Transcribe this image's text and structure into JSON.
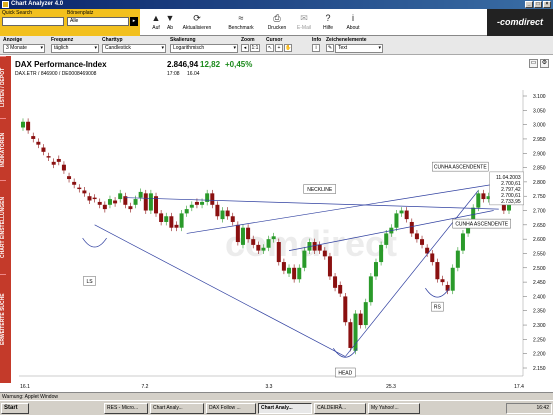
{
  "window": {
    "title": "Chart Analyzer 4.0"
  },
  "toolbar": {
    "quick_search_label": "Quick Search",
    "quick_search_value": "",
    "boersenplatz_label": "Börsenplatz",
    "boersenplatz_value": "Alle",
    "buttons": [
      "Auf",
      "Ab",
      "Aktualisieren",
      "Benchmark",
      "Drucken",
      "E-Mail",
      "Hilfe",
      "About"
    ],
    "logo": "-comdirect"
  },
  "controls": {
    "anzeige_label": "Anzeige",
    "anzeige_value": "3 Monate",
    "frequenz_label": "Frequenz",
    "frequenz_value": "täglich",
    "charttyp_label": "Charttyp",
    "charttyp_value": "Candlestick",
    "skalierung_label": "Skalierung",
    "skalierung_value": "Logarithmisch",
    "zoom_label": "Zoom",
    "zoom_value": "1:1",
    "cursor_label": "Cursor",
    "info_label": "Info",
    "zeichen_label": "Zeichenelemente",
    "zeichen_value": "Text"
  },
  "sidebar": {
    "tabs": [
      "LISTEN / DEPOT",
      "INDIKATOREN",
      "CHART EINSTELLUNGEN",
      "ERWEITERTE SUCHE"
    ]
  },
  "chart_header": {
    "title": "DAX Performance-Index",
    "subtitle": "DAX.ETR / 846900 / DE0008469008",
    "price": "2.846,94",
    "change": "12,82",
    "change_pct": "+0,45%",
    "time1": "17:08",
    "time2": "16.04"
  },
  "chart_data": {
    "type": "candlestick",
    "y_ticks": [
      "3.100",
      "3.050",
      "3.000",
      "2.950",
      "2.900",
      "2.850",
      "2.800",
      "2.750",
      "2.700",
      "2.650",
      "2.600",
      "2.550",
      "2.500",
      "2.450",
      "2.400",
      "2.350",
      "2.300",
      "2.250",
      "2.200",
      "2.150"
    ],
    "x_ticks": [
      "16.1",
      "7.2",
      "3.3",
      "25.3",
      "17.4"
    ],
    "ylim": [
      2150,
      3100
    ],
    "annotations": [
      "LS",
      "HEAD",
      "RS",
      "NECKLINE",
      "CUNHA ASCENDENTE",
      "CUNHA ASCENDENTE"
    ],
    "info_box": [
      "11.04.2003",
      "2.700,61",
      "2.797,42",
      "2.700,61",
      "2.733,95"
    ],
    "watermark": "comdirect",
    "closes": [
      3010,
      2980,
      2950,
      2930,
      2905,
      2885,
      2860,
      2870,
      2840,
      2810,
      2790,
      2775,
      2760,
      2735,
      2740,
      2720,
      2705,
      2740,
      2725,
      2760,
      2720,
      2705,
      2740,
      2765,
      2700,
      2760,
      2690,
      2660,
      2680,
      2640,
      2640,
      2690,
      2705,
      2720,
      2720,
      2730,
      2760,
      2720,
      2680,
      2700,
      2680,
      2660,
      2590,
      2640,
      2600,
      2580,
      2560,
      2570,
      2600,
      2610,
      2520,
      2490,
      2500,
      2460,
      2500,
      2560,
      2590,
      2560,
      2560,
      2540,
      2470,
      2430,
      2410,
      2310,
      2220,
      2340,
      2300,
      2380,
      2470,
      2520,
      2580,
      2620,
      2640,
      2690,
      2700,
      2670,
      2620,
      2600,
      2580,
      2550,
      2520,
      2460,
      2450,
      2420,
      2500,
      2560,
      2620,
      2660,
      2710,
      2760,
      2740,
      2750,
      2800,
      2760,
      2700,
      2730
    ],
    "opens": [
      2990,
      3010,
      2960,
      2940,
      2920,
      2890,
      2870,
      2880,
      2860,
      2820,
      2800,
      2780,
      2770,
      2750,
      2745,
      2730,
      2720,
      2720,
      2735,
      2740,
      2750,
      2715,
      2720,
      2745,
      2760,
      2700,
      2750,
      2690,
      2660,
      2680,
      2650,
      2640,
      2690,
      2710,
      2730,
      2720,
      2730,
      2760,
      2720,
      2670,
      2700,
      2680,
      2650,
      2580,
      2640,
      2600,
      2580,
      2560,
      2570,
      2600,
      2590,
      2520,
      2480,
      2500,
      2460,
      2500,
      2560,
      2590,
      2580,
      2560,
      2540,
      2470,
      2440,
      2400,
      2310,
      2210,
      2340,
      2300,
      2380,
      2470,
      2520,
      2580,
      2620,
      2640,
      2690,
      2700,
      2660,
      2620,
      2600,
      2570,
      2550,
      2520,
      2460,
      2440,
      2420,
      2500,
      2560,
      2620,
      2660,
      2710,
      2760,
      2740,
      2750,
      2790,
      2760,
      2700
    ]
  },
  "statusbar": {
    "text": "Warnung: Applet Window"
  },
  "taskbar": {
    "start": "Start",
    "items": [
      "RES - Micro...",
      "Chart Analy...",
      "DAX Follow ...",
      "Chart Analy...",
      "CALDEIRÃ...",
      "My Yahoo!..."
    ],
    "clock": "16:42"
  },
  "colors": {
    "up": "#2a9a2a",
    "down": "#8a1010",
    "lines": "#3040a0",
    "sidebar": "#c43a2a",
    "toolbar": "#f2c01e"
  }
}
